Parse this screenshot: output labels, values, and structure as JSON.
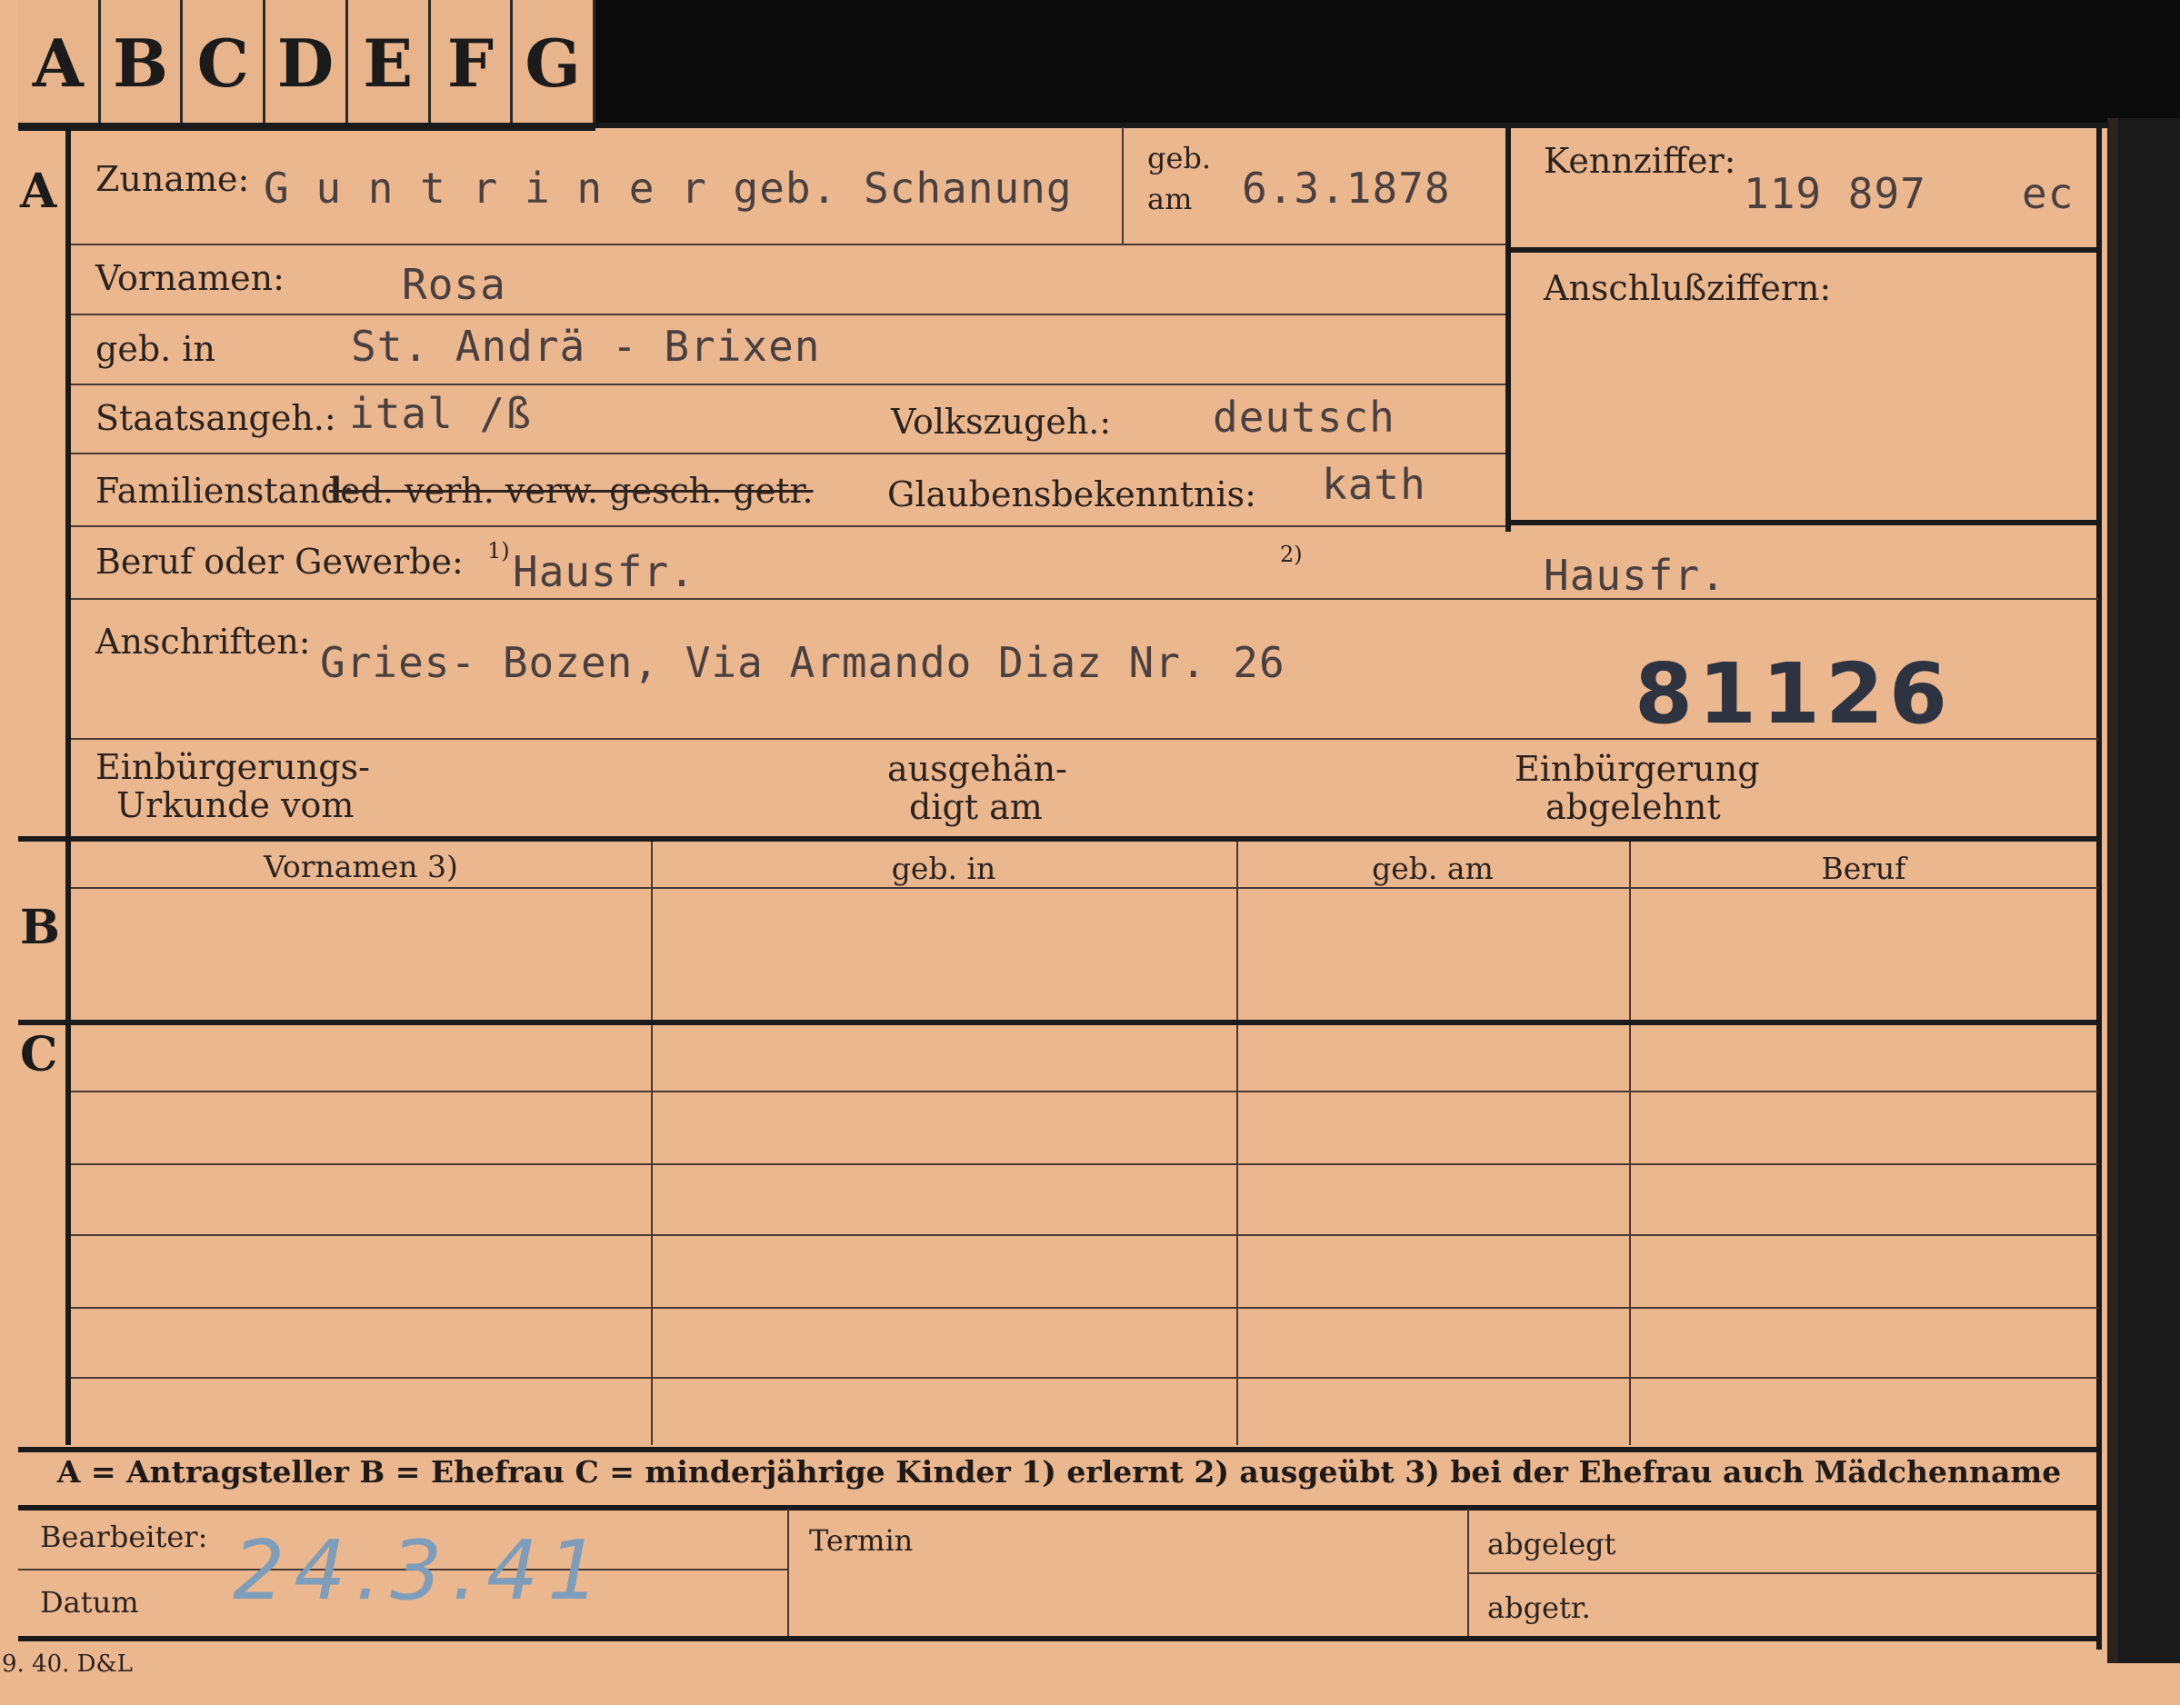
{
  "tabs": [
    "A",
    "B",
    "C",
    "D",
    "E",
    "F",
    "G"
  ],
  "section_letters": {
    "a": "A",
    "b": "B",
    "c": "C"
  },
  "labels": {
    "zuname": "Zuname:",
    "geb_am_1": "geb.",
    "geb_am_2": "am",
    "kennziffer": "Kennziffer:",
    "anschlussziffern": "Anschlußziffern:",
    "vornamen": "Vornamen:",
    "geb_in": "geb. in",
    "staatsangeh": "Staatsangeh.:",
    "volkszugeh": "Volkszugeh.:",
    "familienstand": "Familienstand:",
    "familienstand_options": "led. verh. verw. gesch. getr.",
    "glaubensbekenntnis": "Glaubensbekenntnis:",
    "beruf": "Beruf oder Gewerbe:",
    "fn1": "1)",
    "fn2": "2)",
    "anschriften": "Anschriften:",
    "einb_urkunde_1": "Einbürgerungs-",
    "einb_urkunde_2": "Urkunde vom",
    "ausgehaendigt_1": "ausgehän-",
    "ausgehaendigt_2": "digt am",
    "einb_abgelehnt_1": "Einbürgerung",
    "einb_abgelehnt_2": "abgelehnt",
    "bearbeiter": "Bearbeiter:",
    "datum": "Datum",
    "termin": "Termin",
    "abgelegt": "abgelegt",
    "abgetr": "abgetr."
  },
  "values": {
    "zuname": "G u n t r i n e r  geb. Schanung",
    "geb_am": "6.3.1878",
    "kennziffer": "119 897",
    "kennziffer_suffix": "ec",
    "vornamen": "Rosa",
    "geb_in": "St. Andrä - Brixen",
    "staatsangeh": "ital /ß",
    "volkszugeh": "deutsch",
    "glaubensbekenntnis": "kath",
    "beruf_erlernt": "Hausfr.",
    "beruf_ausgeuebt": "Hausfr.",
    "anschrift": "Gries- Bozen, Via Armando Diaz Nr. 26",
    "stamp_number": "81126",
    "datum_handwritten": "24.3.41"
  },
  "table_headers": [
    "Vornamen 3)",
    "geb. in",
    "geb. am",
    "Beruf"
  ],
  "legend": "A = Antragsteller   B = Ehefrau   C = minderjährige Kinder   1) erlernt   2) ausgeübt   3) bei der Ehefrau auch Mädchenname",
  "print_mark": "9. 40. D&L"
}
